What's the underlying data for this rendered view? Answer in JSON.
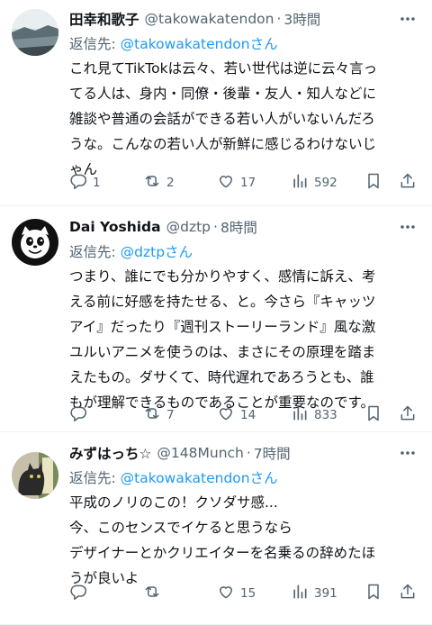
{
  "tweets": [
    {
      "display_name": "田幸和歌子",
      "handle": "@takowakatendon",
      "dot": "·",
      "time_ago": "3時間",
      "reply_prefix": "返信先: ",
      "reply_to": "@takowakatendonさん",
      "body_lines": [
        "これ見てTikTokは云々、若い世代は逆に云々言っ",
        "てる人は、身内・同僚・後輩・友人・知人などに",
        "雑談や普通の会話ができる若い人がいないんだろ",
        "うな。こんなの若い人が新鮮に感じるわけないじ",
        "ゃん"
      ],
      "replies": "1",
      "reposts": "2",
      "likes": "17",
      "views": "592"
    },
    {
      "display_name": "Dai Yoshida",
      "handle": "@dztp",
      "dot": "·",
      "time_ago": "8時間",
      "reply_prefix": "返信先: ",
      "reply_to": "@dztpさん",
      "body_lines": [
        "つまり、誰にでも分かりやすく、感情に訴え、考",
        "える前に好感を持たせる、と。今さら『キャッツ",
        "アイ』だったり『週刊ストーリーランド』風な激",
        "ユルいアニメを使うのは、まさにその原理を踏ま",
        "えたもの。ダサくて、時代遅れであろうとも、誰",
        "もが理解できるものであることが重要なのです。"
      ],
      "replies": "",
      "reposts": "7",
      "likes": "14",
      "views": "833"
    },
    {
      "display_name": "みずはっち☆",
      "handle": "@148Munch",
      "dot": "·",
      "time_ago": "7時間",
      "reply_prefix": "返信先: ",
      "reply_to": "@takowakatendonさん",
      "body_lines": [
        "平成のノリのこの！クソダサ感...",
        "今、このセンスでイケると思うなら",
        "デザイナーとかクリエイターを名乗るの辞めたほ",
        "うが良いよ"
      ],
      "replies": "",
      "reposts": "",
      "likes": "15",
      "views": "391"
    }
  ],
  "icons": {
    "avatar_1": "landscape-avatar",
    "avatar_2": "cat-cartoon-avatar",
    "avatar_3": "cat-photo-avatar",
    "more": "more-options-icon",
    "reply": "reply-icon",
    "repost": "repost-icon",
    "like": "heart-icon",
    "views": "views-icon",
    "bookmark": "bookmark-icon",
    "share": "share-icon"
  },
  "colors": {
    "link": "#1d9bf0",
    "muted": "#536471",
    "text": "#0f1419",
    "divider": "#eff3f4"
  }
}
